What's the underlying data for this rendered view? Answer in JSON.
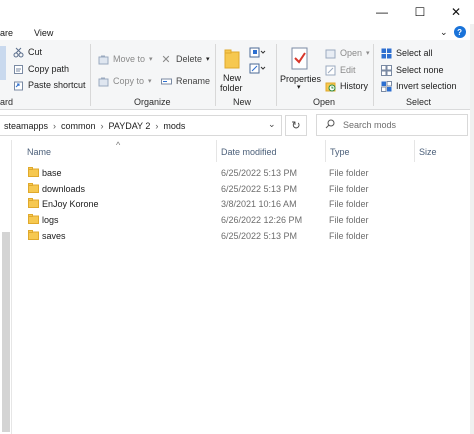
{
  "window": {
    "tabs": [
      "are",
      "View"
    ],
    "minimize": "—",
    "maximize": "☐",
    "close": "✕"
  },
  "ribbon": {
    "clipboard": {
      "cut": "Cut",
      "copy_path": "Copy path",
      "paste_shortcut": "Paste shortcut",
      "label_fragment": "ard"
    },
    "organize": {
      "move_to": "Move to",
      "copy_to": "Copy to",
      "delete": "Delete",
      "rename": "Rename",
      "label": "Organize"
    },
    "new": {
      "new_folder_line1": "New",
      "new_folder_line2": "folder",
      "label": "New"
    },
    "open": {
      "properties": "Properties",
      "open": "Open",
      "edit": "Edit",
      "history": "History",
      "label": "Open"
    },
    "select": {
      "select_all": "Select all",
      "select_none": "Select none",
      "invert_selection": "Invert selection",
      "label": "Select"
    }
  },
  "address": {
    "crumbs": [
      "steamapps",
      "common",
      "PAYDAY 2",
      "mods"
    ],
    "search_placeholder": "Search mods"
  },
  "columns": {
    "name": "Name",
    "date": "Date modified",
    "type": "Type",
    "size": "Size"
  },
  "files": [
    {
      "name": "base",
      "date": "6/25/2022 5:13 PM",
      "type": "File folder"
    },
    {
      "name": "downloads",
      "date": "6/25/2022 5:13 PM",
      "type": "File folder"
    },
    {
      "name": "EnJoy Korone",
      "date": "3/8/2021 10:16 AM",
      "type": "File folder"
    },
    {
      "name": "logs",
      "date": "6/26/2022 12:26 PM",
      "type": "File folder"
    },
    {
      "name": "saves",
      "date": "6/25/2022 5:13 PM",
      "type": "File folder"
    }
  ],
  "colors": {
    "folder": "#f6c850",
    "folder_dark": "#e0a92c",
    "accent": "#1a73d9",
    "header_text": "#4c607a"
  }
}
